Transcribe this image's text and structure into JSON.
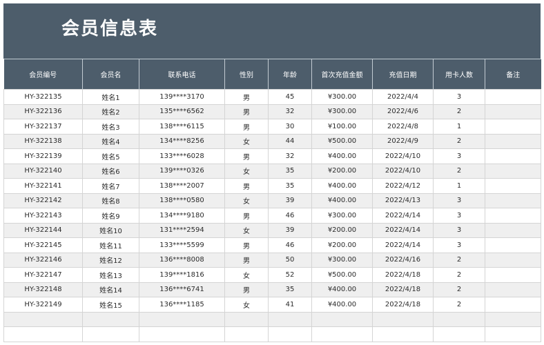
{
  "title": "会员信息表",
  "header_color": "#4d5d6b",
  "columns": [
    "会员编号",
    "会员名",
    "联系电话",
    "性别",
    "年龄",
    "首次充值金额",
    "充值日期",
    "用卡人数",
    "备注"
  ],
  "rows": [
    [
      "HY-322135",
      "姓名1",
      "139****3170",
      "男",
      "45",
      "¥300.00",
      "2022/4/4",
      "3",
      ""
    ],
    [
      "HY-322136",
      "姓名2",
      "135****6562",
      "男",
      "32",
      "¥300.00",
      "2022/4/6",
      "2",
      ""
    ],
    [
      "HY-322137",
      "姓名3",
      "138****6115",
      "男",
      "30",
      "¥100.00",
      "2022/4/8",
      "1",
      ""
    ],
    [
      "HY-322138",
      "姓名4",
      "134****8256",
      "女",
      "44",
      "¥500.00",
      "2022/4/9",
      "2",
      ""
    ],
    [
      "HY-322139",
      "姓名5",
      "133****6028",
      "男",
      "32",
      "¥400.00",
      "2022/4/10",
      "3",
      ""
    ],
    [
      "HY-322140",
      "姓名6",
      "139****0326",
      "女",
      "35",
      "¥200.00",
      "2022/4/10",
      "2",
      ""
    ],
    [
      "HY-322141",
      "姓名7",
      "138****2007",
      "男",
      "35",
      "¥400.00",
      "2022/4/12",
      "1",
      ""
    ],
    [
      "HY-322142",
      "姓名8",
      "138****0580",
      "女",
      "39",
      "¥400.00",
      "2022/4/13",
      "3",
      ""
    ],
    [
      "HY-322143",
      "姓名9",
      "134****9180",
      "男",
      "46",
      "¥300.00",
      "2022/4/14",
      "3",
      ""
    ],
    [
      "HY-322144",
      "姓名10",
      "131****2594",
      "女",
      "39",
      "¥200.00",
      "2022/4/14",
      "3",
      ""
    ],
    [
      "HY-322145",
      "姓名11",
      "133****5599",
      "男",
      "46",
      "¥200.00",
      "2022/4/14",
      "3",
      ""
    ],
    [
      "HY-322146",
      "姓名12",
      "136****8008",
      "男",
      "50",
      "¥300.00",
      "2022/4/16",
      "2",
      ""
    ],
    [
      "HY-322147",
      "姓名13",
      "139****1816",
      "女",
      "52",
      "¥500.00",
      "2022/4/18",
      "2",
      ""
    ],
    [
      "HY-322148",
      "姓名14",
      "136****6741",
      "男",
      "35",
      "¥400.00",
      "2022/4/18",
      "2",
      ""
    ],
    [
      "HY-322149",
      "姓名15",
      "136****1185",
      "女",
      "41",
      "¥400.00",
      "2022/4/18",
      "2",
      ""
    ],
    [
      "",
      "",
      "",
      "",
      "",
      "",
      "",
      "",
      ""
    ],
    [
      "",
      "",
      "",
      "",
      "",
      "",
      "",
      "",
      ""
    ]
  ]
}
